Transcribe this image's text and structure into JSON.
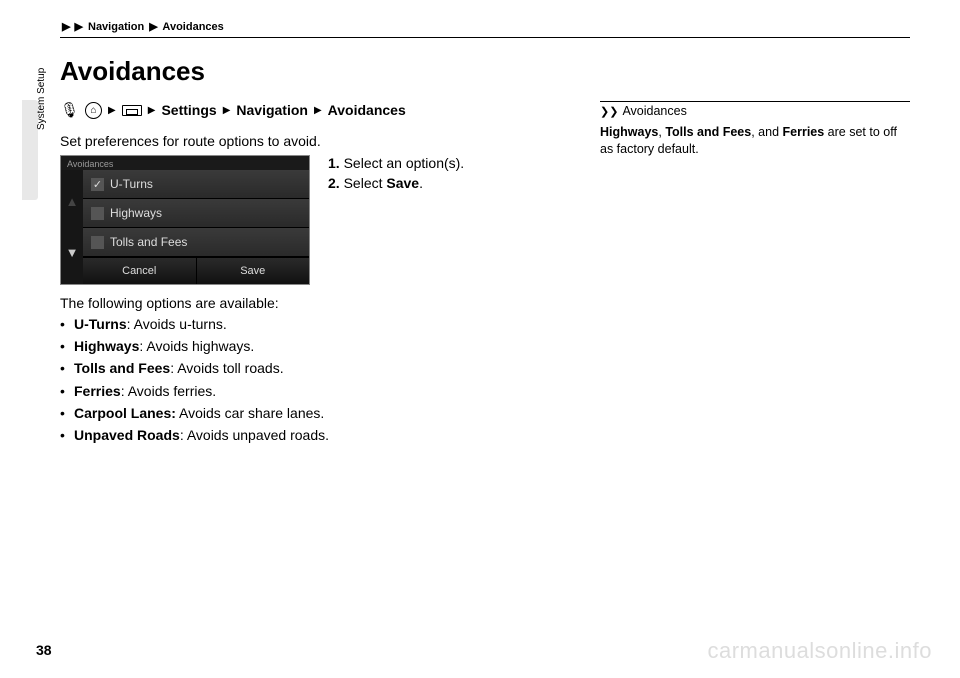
{
  "header": {
    "crumb1": "Navigation",
    "crumb2": "Avoidances",
    "sep": "▶"
  },
  "sideTab": "System Setup",
  "title": "Avoidances",
  "path": {
    "arrow": "▶",
    "settings": "Settings",
    "navigation": "Navigation",
    "avoidances": "Avoidances"
  },
  "intro": "Set preferences for route options to avoid.",
  "shot": {
    "title": "Avoidances",
    "rows": [
      "U-Turns",
      "Highways",
      "Tolls and Fees"
    ],
    "checked": "✓",
    "scrollDown": "▼",
    "btnCancel": "Cancel",
    "btnSave": "Save"
  },
  "steps": {
    "s1n": "1.",
    "s1": "Select an option(s).",
    "s2n": "2.",
    "s2a": "Select ",
    "s2b": "Save",
    "s2c": "."
  },
  "optsIntro": "The following options are available:",
  "opts": [
    {
      "b": "U-Turns",
      "t": ": Avoids u-turns."
    },
    {
      "b": "Highways",
      "t": ": Avoids highways."
    },
    {
      "b": "Tolls and Fees",
      "t": ": Avoids toll roads."
    },
    {
      "b": "Ferries",
      "t": ": Avoids ferries."
    },
    {
      "b": "Carpool Lanes:",
      "t": " Avoids car share lanes."
    },
    {
      "b": "Unpaved Roads",
      "t": ": Avoids unpaved roads."
    }
  ],
  "right": {
    "chev": "❯❯",
    "title": "Avoidances",
    "a": "Highways",
    "b": "Tolls and Fees",
    "c": "Ferries",
    "mid1": ", ",
    "mid2": ", and ",
    "tail": " are set to off as factory default."
  },
  "pageNum": "38",
  "watermark": "carmanualsonline.info"
}
